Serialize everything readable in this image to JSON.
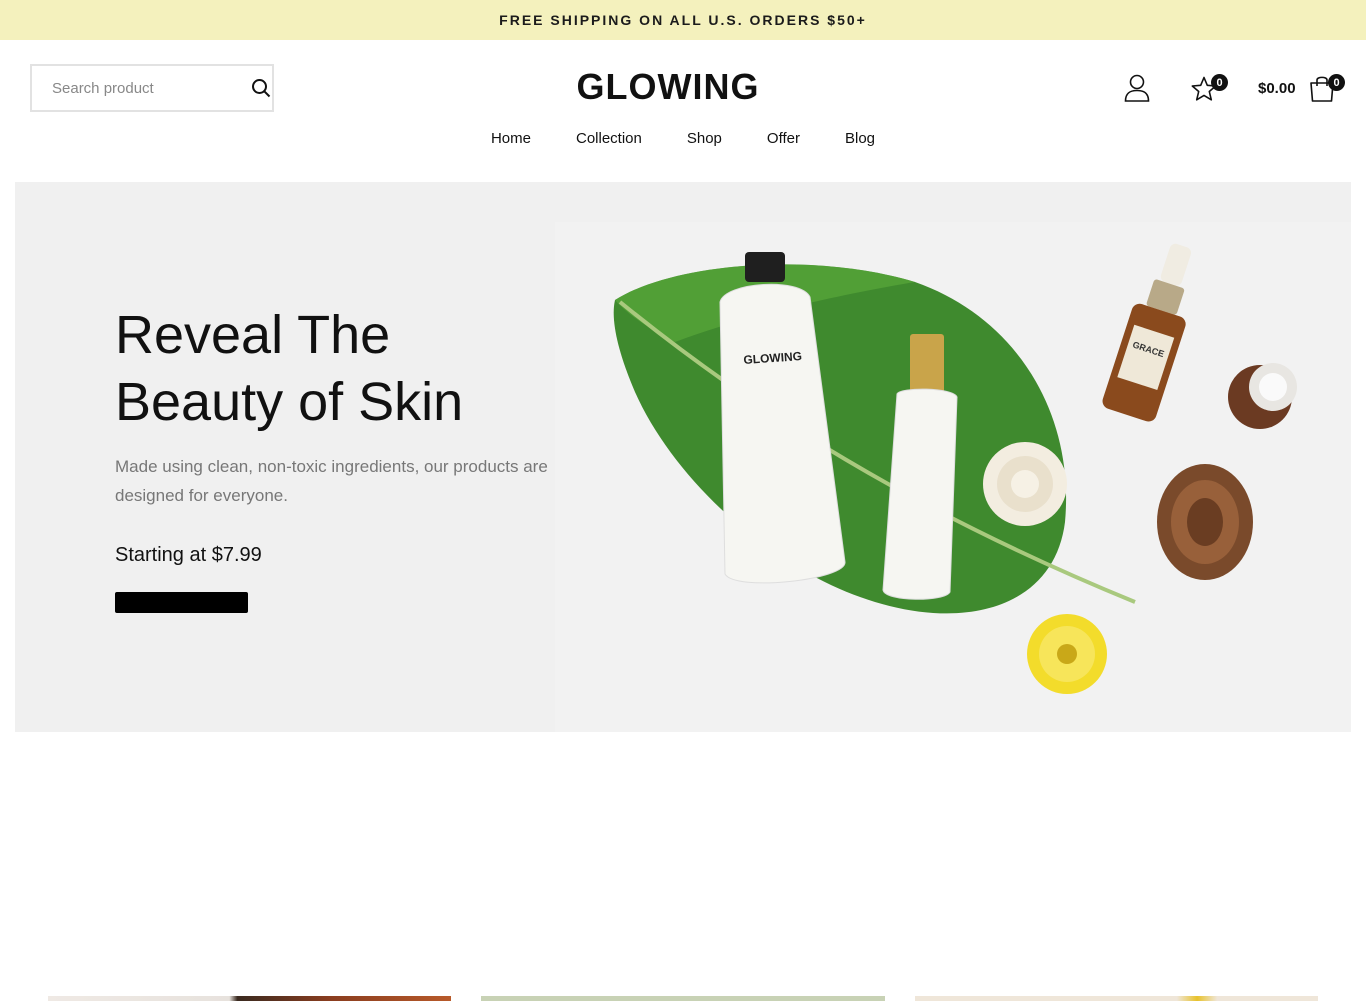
{
  "announcement": {
    "text": "FREE SHIPPING ON ALL U.S. ORDERS $50+"
  },
  "search": {
    "placeholder": "Search product"
  },
  "brand": {
    "name": "GLOWING"
  },
  "header": {
    "wishlist_count": "0",
    "cart_count": "0",
    "cart_total": "$0.00"
  },
  "nav": {
    "items": [
      "Home",
      "Collection",
      "Shop",
      "Offer",
      "Blog"
    ]
  },
  "hero": {
    "title_line1": "Reveal The",
    "title_line2": "Beauty of Skin",
    "subtitle": "Made using clean, non-toxic ingredients, our products are designed for everyone.",
    "price_text": "Starting at $7.99",
    "cta_label": "",
    "image_texts": {
      "tube_brand": "GLOWING",
      "tube_small_print": "MADE USING CLEAN, NON-TOXIC INGREDIENTS, OUR PRODUCTS ARE DESIGNED FOR EVERYONE.",
      "bottle_label": "GRACE"
    }
  },
  "colors": {
    "announcement_bg": "#f4f1bd",
    "hero_bg": "#f0f0f0",
    "text": "#111111",
    "muted": "#777777"
  }
}
